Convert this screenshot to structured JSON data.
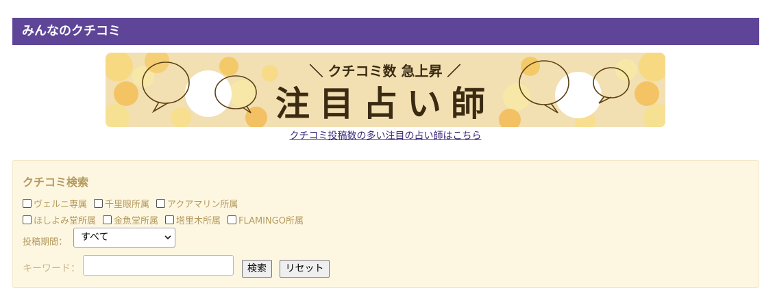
{
  "header": {
    "title": "みんなのクチコミ"
  },
  "banner": {
    "subtitle": "＼ クチコミ数 急上昇 ／",
    "headline": "注目占い師",
    "link_text": "クチコミ投稿数の多い注目の占い師はこちら"
  },
  "search": {
    "title": "クチコミ検索",
    "checkbox_rows": [
      [
        {
          "label": "ヴェルニ専属",
          "checked": false
        },
        {
          "label": "千里眼所属",
          "checked": false
        },
        {
          "label": "アクアマリン所属",
          "checked": false
        }
      ],
      [
        {
          "label": "ほしよみ堂所属",
          "checked": false
        },
        {
          "label": "金魚堂所属",
          "checked": false
        },
        {
          "label": "塔里木所属",
          "checked": false
        },
        {
          "label": "FLAMINGO所属",
          "checked": false
        }
      ]
    ],
    "period_label": "投稿期間：",
    "period_selected": "すべて",
    "keyword_label": "キーワード：",
    "keyword_value": "",
    "search_button": "検索",
    "reset_button": "リセット"
  },
  "colors": {
    "header_bg": "#5f4598",
    "panel_bg": "#fdf7e2",
    "label_text": "#b59a5e",
    "link": "#3b2a78"
  }
}
